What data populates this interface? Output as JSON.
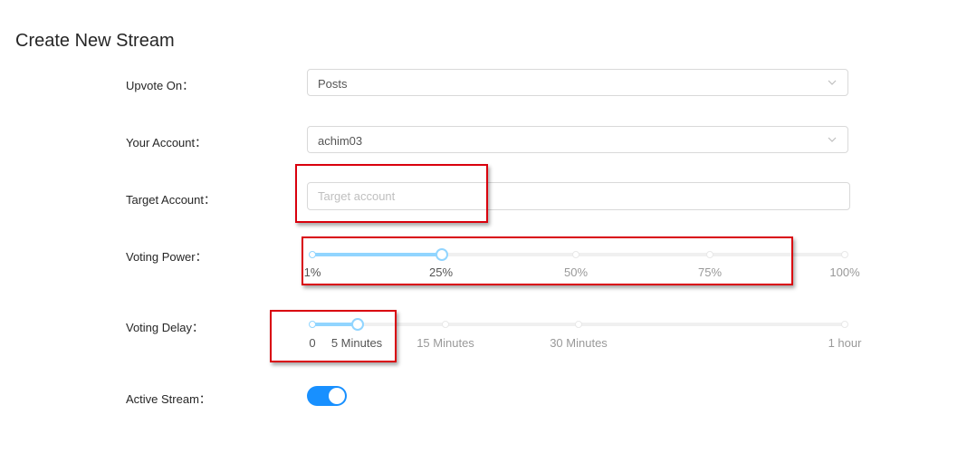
{
  "page_title": "Create New Stream",
  "upvote_on": {
    "label": "Upvote On：",
    "value": "Posts",
    "icon": "chevron-down-icon"
  },
  "your_account": {
    "label": "Your Account：",
    "value": "achim03",
    "icon": "chevron-down-icon"
  },
  "target_account": {
    "label": "Target Account：",
    "value": "",
    "placeholder": "Target account"
  },
  "voting_power": {
    "label": "Voting Power：",
    "value_percent": 25,
    "marks": [
      "1%",
      "25%",
      "50%",
      "75%",
      "100%"
    ]
  },
  "voting_delay": {
    "label": "Voting Delay：",
    "value": "5 Minutes",
    "marks": [
      "0",
      "5 Minutes",
      "15 Minutes",
      "30 Minutes",
      "1 hour"
    ]
  },
  "active_stream": {
    "label": "Active Stream：",
    "checked": true
  },
  "colors": {
    "accent": "#1890ff",
    "slider_track": "#91d5ff",
    "annotation": "#d9000d"
  }
}
